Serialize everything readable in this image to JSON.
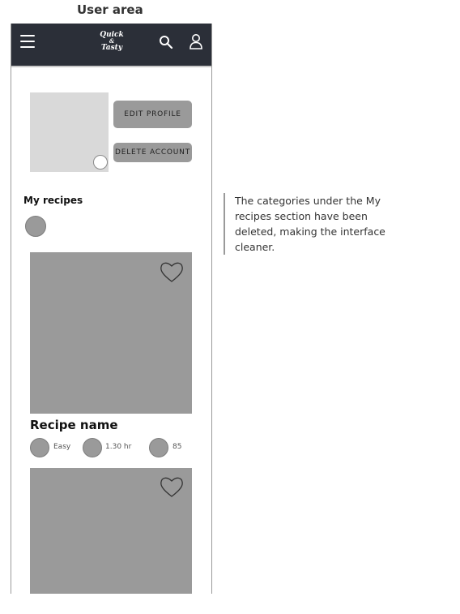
{
  "caption": "User area",
  "header": {
    "logo_line1": "Quick",
    "logo_amp": "&",
    "logo_line2": "Tasty"
  },
  "profile": {
    "edit_label": "EDIT PROFILE",
    "delete_label": "DELETE ACCOUNT"
  },
  "my_recipes": {
    "title": "My recipes"
  },
  "recipe": {
    "name": "Recipe name",
    "difficulty": "Easy",
    "time": "1.30 hr",
    "score": "85"
  },
  "note": "The categories under the My recipes section have been deleted, making the interface cleaner.",
  "colors": {
    "topbar": "#2b2f38",
    "placeholder_gray": "#9a9a9a",
    "avatar_gray": "#d9d9d9"
  },
  "icons": [
    "hamburger-icon",
    "search-icon",
    "user-icon",
    "heart-icon"
  ]
}
